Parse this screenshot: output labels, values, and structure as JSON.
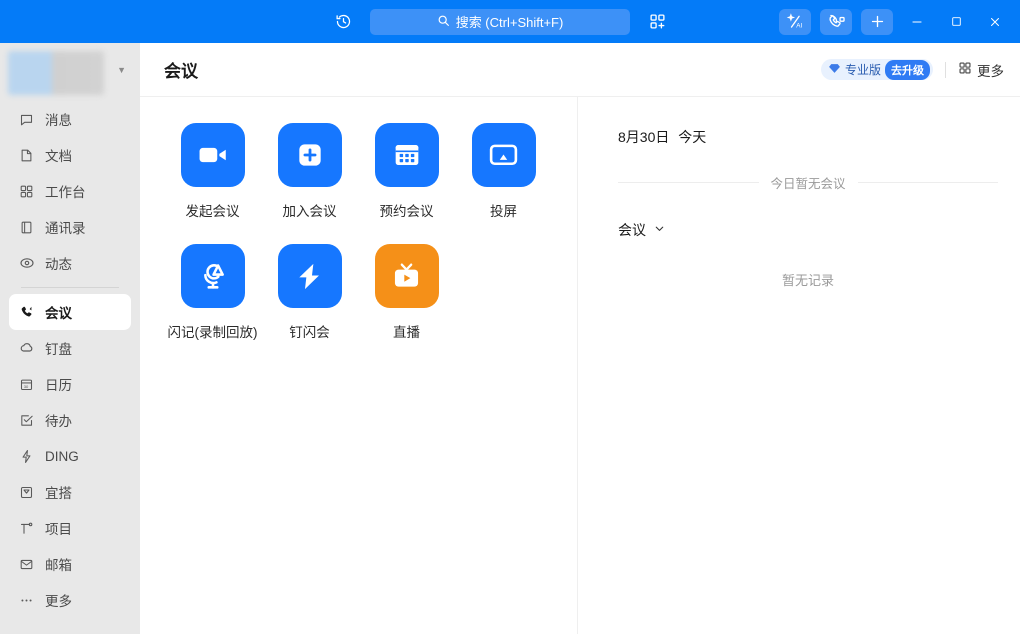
{
  "titlebar": {
    "history_icon": "history-icon",
    "search": {
      "placeholder": "搜索 (Ctrl+Shift+F)",
      "icon": "search-icon"
    },
    "apps_icon": "apps-add-icon",
    "ai_icon": "ai-assistant-icon",
    "call_icon": "phone-call-icon",
    "add_icon": "plus-icon",
    "minimize_icon": "minimize-icon",
    "maximize_icon": "maximize-icon",
    "close_icon": "close-icon"
  },
  "sidebar": {
    "profile_caret": "chevron-down-icon",
    "items": [
      {
        "label": "消息",
        "icon": "message-icon",
        "active": false
      },
      {
        "label": "文档",
        "icon": "document-icon",
        "active": false
      },
      {
        "label": "工作台",
        "icon": "workbench-icon",
        "active": false
      },
      {
        "label": "通讯录",
        "icon": "contacts-icon",
        "active": false
      },
      {
        "label": "动态",
        "icon": "feed-eye-icon",
        "active": false
      },
      {
        "label": "会议",
        "icon": "meeting-phone-icon",
        "active": true
      },
      {
        "label": "钉盘",
        "icon": "cloud-drive-icon",
        "active": false
      },
      {
        "label": "日历",
        "icon": "calendar-icon",
        "active": false
      },
      {
        "label": "待办",
        "icon": "todo-check-icon",
        "active": false
      },
      {
        "label": "DING",
        "icon": "ding-bolt-icon",
        "active": false
      },
      {
        "label": "宜搭",
        "icon": "yida-icon",
        "active": false
      },
      {
        "label": "项目",
        "icon": "project-icon",
        "active": false
      },
      {
        "label": "邮箱",
        "icon": "mail-icon",
        "active": false
      },
      {
        "label": "更多",
        "icon": "ellipsis-icon",
        "active": false
      }
    ]
  },
  "header": {
    "title": "会议",
    "pro_label": "专业版",
    "upgrade_label": "去升级",
    "pro_icon": "diamond-icon",
    "more_label": "更多",
    "more_icon": "grid-icon"
  },
  "actions": [
    {
      "label": "发起会议",
      "icon": "video-camera-icon",
      "color": "blue"
    },
    {
      "label": "加入会议",
      "icon": "plus-square-icon",
      "color": "blue"
    },
    {
      "label": "预约会议",
      "icon": "calendar-icon",
      "color": "blue"
    },
    {
      "label": "投屏",
      "icon": "screen-cast-icon",
      "color": "blue"
    },
    {
      "label": "闪记(录制回放)",
      "icon": "microphone-ai-icon",
      "color": "blue"
    },
    {
      "label": "钉闪会",
      "icon": "lightning-icon",
      "color": "blue"
    },
    {
      "label": "直播",
      "icon": "live-tv-icon",
      "color": "orange"
    }
  ],
  "schedule": {
    "date": "8月30日",
    "today": "今天",
    "no_meeting_text": "今日暂无会议",
    "filter_label": "会议",
    "filter_icon": "chevron-down-icon",
    "empty_record_text": "暂无记录"
  }
}
